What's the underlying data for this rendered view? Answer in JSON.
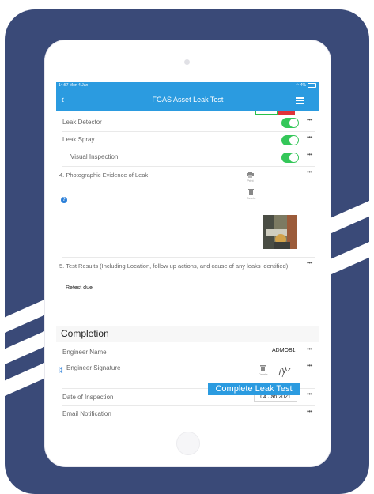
{
  "statusbar": {
    "time": "14:57",
    "date": "Mon 4 Jan",
    "battery": "4%"
  },
  "navbar": {
    "back_glyph": "‹",
    "title": "FGAS Asset Leak Test"
  },
  "checklist": [
    {
      "label": "Leak Detector",
      "enabled": true
    },
    {
      "label": "Leak Spray",
      "enabled": true
    },
    {
      "label": "Visual Inspection",
      "enabled": true
    }
  ],
  "photo_section": {
    "number": "4.",
    "label": "Photographic Evidence of  Leak",
    "print_label": "Print",
    "delete_label": "Delete"
  },
  "test_results": {
    "number": "5.",
    "label": "Test Results (Including Location, follow up actions, and cause of any leaks identified)",
    "value": "Retest due"
  },
  "completion": {
    "title": "Completion",
    "engineer_name_label": "Engineer Name",
    "engineer_name_value": "ADMOB1",
    "signature_label": "Engineer Signature",
    "signature_delete_label": "Delete",
    "date_label": "Date of Inspection",
    "date_value": "04 Jan 2021",
    "email_label": "Email Notification"
  },
  "more_glyph": "•••",
  "help_glyph": "?",
  "complete_button": "Complete Leak Test",
  "colors": {
    "accent": "#2b9be0",
    "toggle_on": "#34c759",
    "background_panel": "#3a4a78"
  }
}
